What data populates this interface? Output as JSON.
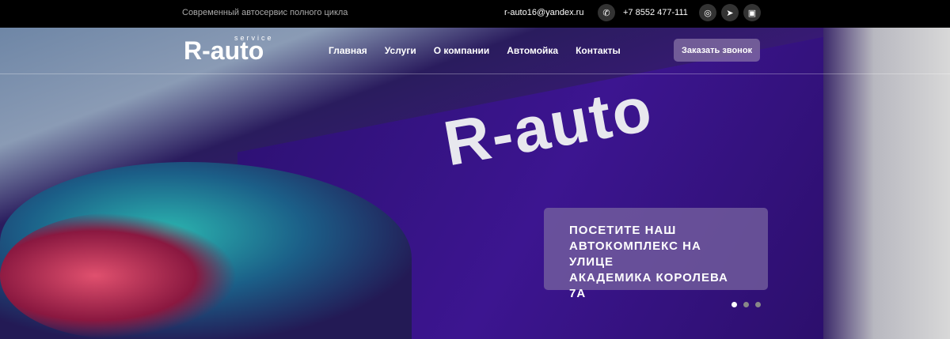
{
  "topbar": {
    "tagline": "Современный автосервис полного цикла",
    "email": "r-auto16@yandex.ru",
    "phone": "+7 8552 477-111"
  },
  "logo": {
    "text": "R-auto",
    "sub": "service"
  },
  "nav": [
    {
      "label": "Главная"
    },
    {
      "label": "Услуги"
    },
    {
      "label": "О компании"
    },
    {
      "label": "Автомойка"
    },
    {
      "label": "Контакты"
    }
  ],
  "cta": "Заказать звонок",
  "hero": {
    "lines": [
      "ПОСЕТИТЕ НАШ",
      "АВТОКОМПЛЕКС НА УЛИЦЕ",
      "АКАДЕМИКА КОРОЛЕВА 7А"
    ],
    "slides": 3,
    "active_slide": 1
  }
}
